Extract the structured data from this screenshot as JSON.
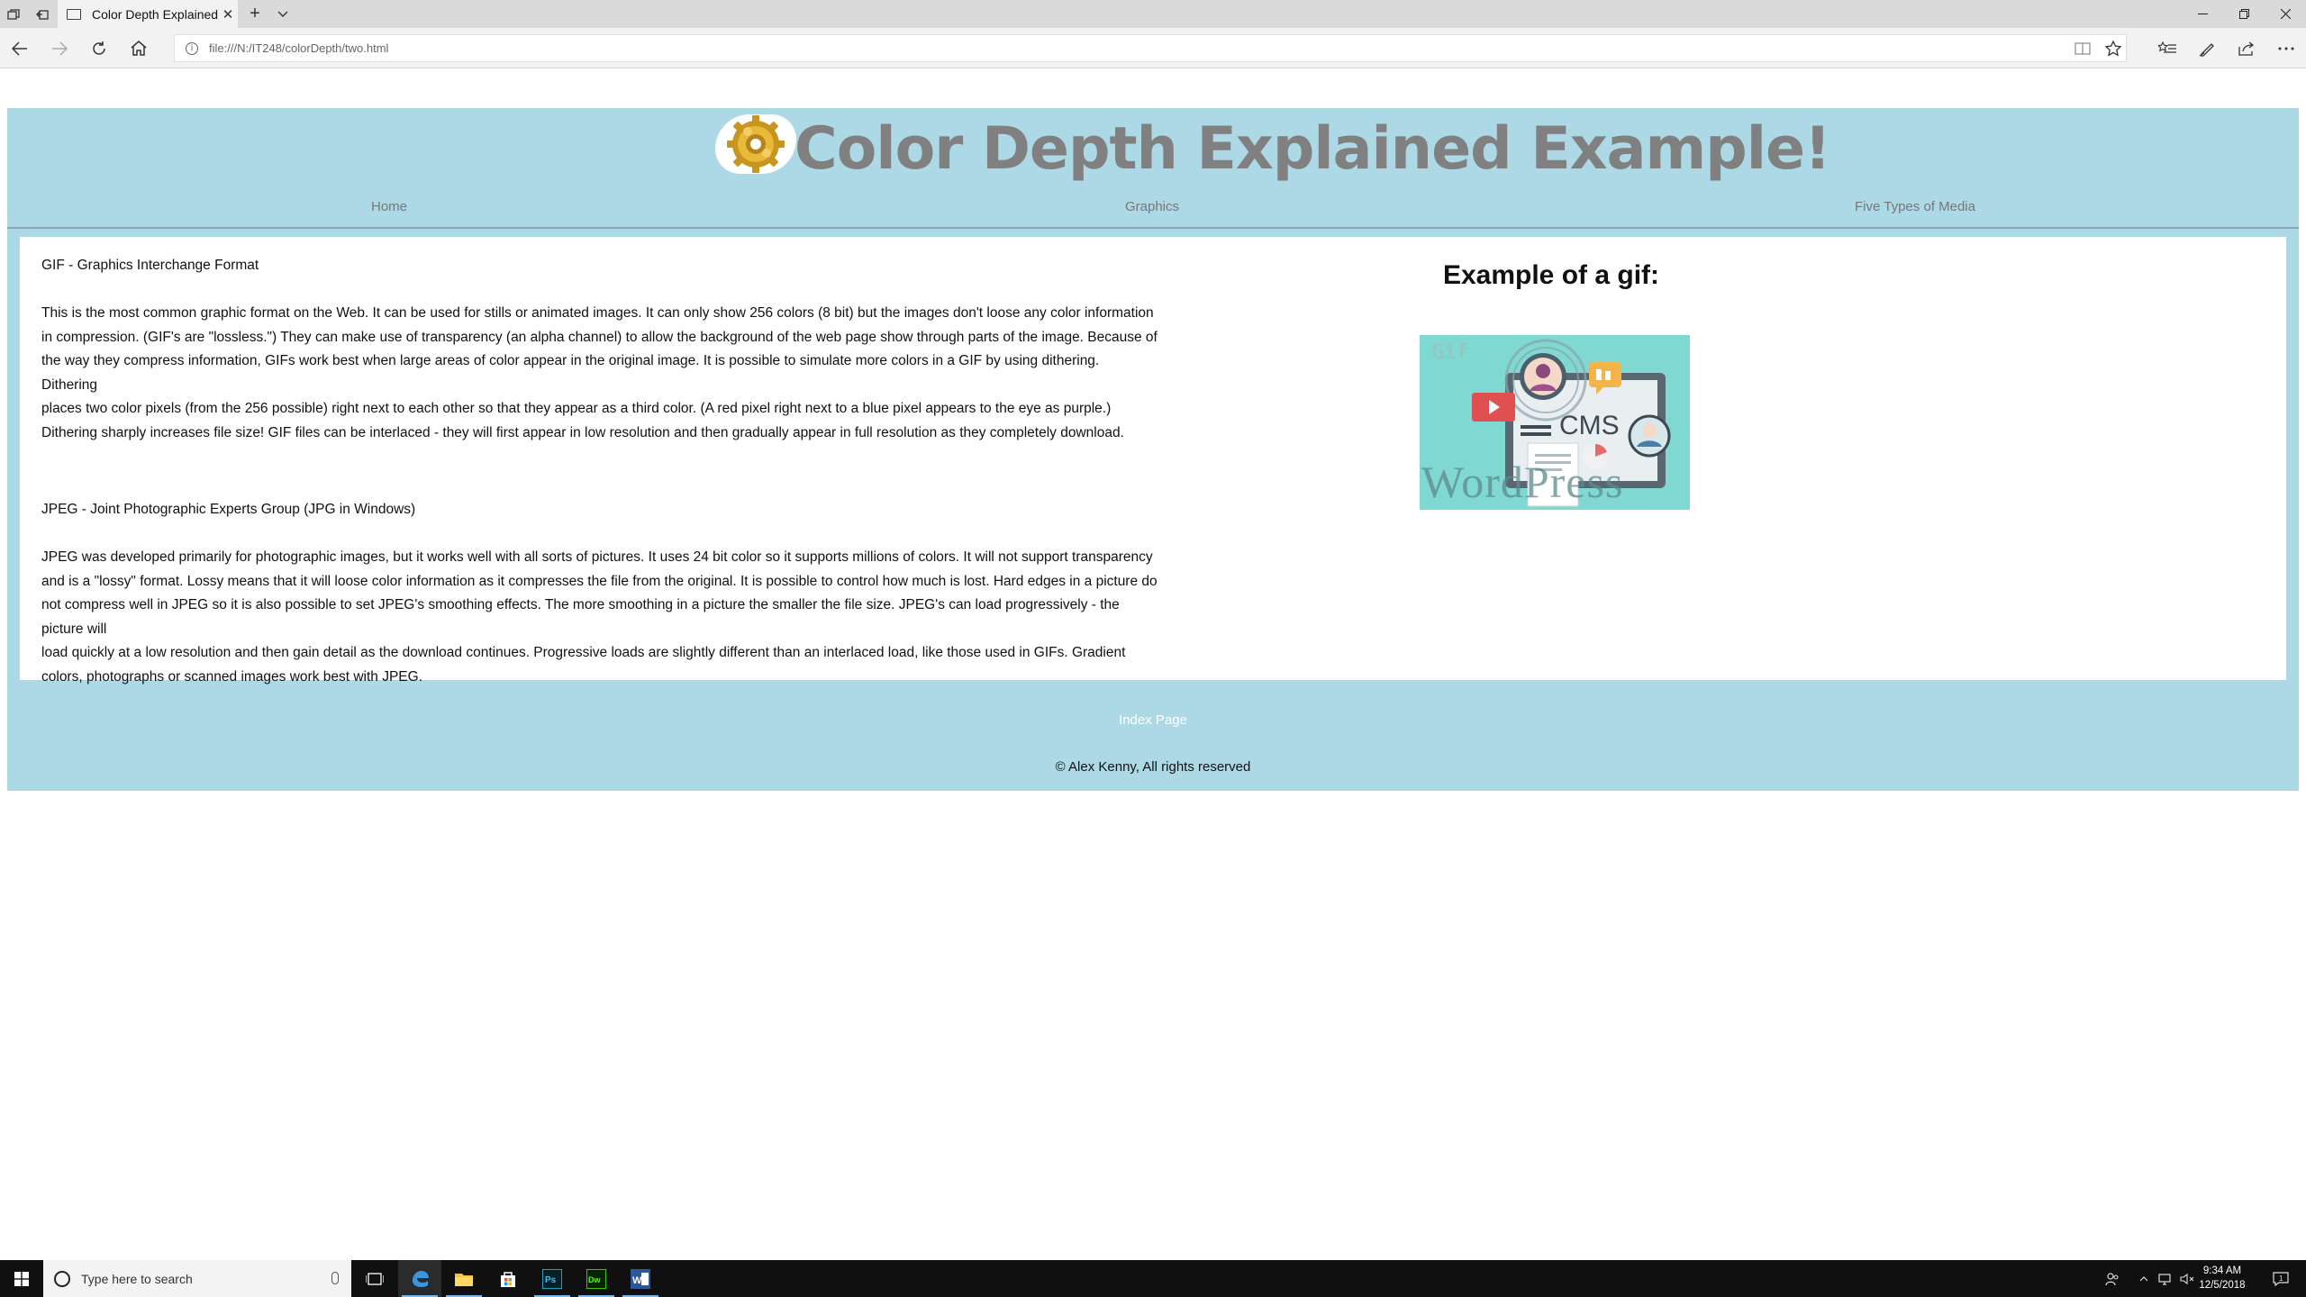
{
  "browser": {
    "tab_title": "Color Depth Explained!",
    "url": "file:///N:/IT248/colorDepth/two.html"
  },
  "site": {
    "title": "Color Depth Explained Example!",
    "nav": [
      "Home",
      "Graphics",
      "Five Types of Media"
    ]
  },
  "main": {
    "gif_heading": "GIF - Graphics Interchange Format",
    "gif_lines": [
      "This is the most common graphic format on the Web. It can be used for stills or animated images. It can only show 256 colors (8 bit) but the images don't loose any color information",
      "in compression. (GIF's are \"lossless.\") They can make use of transparency (an alpha channel) to allow the background of the web page show through parts of the image. Because of",
      "the way they compress information, GIFs work best when large areas of color appear in the original image. It is possible to simulate more colors in a GIF by using dithering. Dithering",
      "places two color pixels (from the 256 possible) right next to each other so that they appear as a third color. (A red pixel right next to a blue pixel appears to the eye as purple.)",
      "Dithering sharply increases file size! GIF files can be interlaced - they will first appear in low resolution and then gradually appear in full resolution as they completely download."
    ],
    "jpeg_heading": "JPEG - Joint Photographic Experts Group (JPG in Windows)",
    "jpeg_lines": [
      "JPEG was developed primarily for photographic images, but it works well with all sorts of pictures. It uses 24 bit color so it supports millions of colors. It will not support transparency",
      "and is a \"lossy\" format. Lossy means that it will loose color information as it compresses the file from the original. It is possible to control how much is lost. Hard edges in a picture do",
      "not compress well in JPEG so it is also possible to set JPEG's smoothing effects. The more smoothing in a picture the smaller the file size. JPEG's can load progressively - the picture will",
      "load quickly at a low resolution and then gain detail as the download continues. Progressive loads are slightly different than an interlaced load, like those used in GIFs. Gradient",
      "colors, photographs or scanned images work best with JPEG."
    ],
    "example_heading": "Example of a gif:",
    "example_image_text": {
      "corner": "Gif",
      "cms": "CMS",
      "wordpress": "WordPress"
    }
  },
  "footer": {
    "index_link": "Index Page",
    "copyright": "© Alex Kenny, All rights reserved"
  },
  "taskbar": {
    "search_placeholder": "Type here to search",
    "time": "9:34 AM",
    "date": "12/5/2018"
  },
  "colors": {
    "page_bg": "#add8e6",
    "title": "#808080",
    "nav": "#777777"
  }
}
